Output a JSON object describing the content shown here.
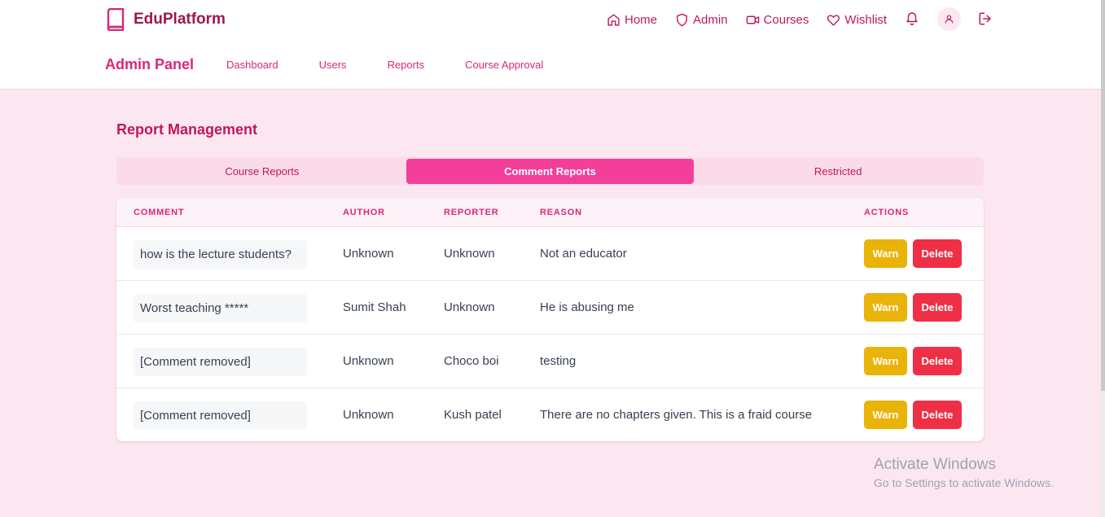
{
  "brand": {
    "name": "EduPlatform"
  },
  "topnav": [
    {
      "label": "Home",
      "icon": "home-icon"
    },
    {
      "label": "Admin",
      "icon": "shield-icon"
    },
    {
      "label": "Courses",
      "icon": "video-icon"
    },
    {
      "label": "Wishlist",
      "icon": "heart-icon"
    }
  ],
  "panel": {
    "title": "Admin Panel"
  },
  "subnav": [
    "Dashboard",
    "Users",
    "Reports",
    "Course Approval"
  ],
  "section": {
    "title": "Report Management"
  },
  "tabs": [
    {
      "label": "Course Reports",
      "active": false
    },
    {
      "label": "Comment Reports",
      "active": true
    },
    {
      "label": "Restricted",
      "active": false
    }
  ],
  "table": {
    "headers": {
      "comment": "COMMENT",
      "author": "AUTHOR",
      "reporter": "REPORTER",
      "reason": "REASON",
      "actions": "ACTIONS"
    },
    "rows": [
      {
        "comment": "how is the lecture students?",
        "author": "Unknown",
        "reporter": "Unknown",
        "reason": "Not an educator"
      },
      {
        "comment": "Worst teaching *****",
        "author": "Sumit Shah",
        "reporter": "Unknown",
        "reason": "He is abusing me"
      },
      {
        "comment": "[Comment removed]",
        "author": "Unknown",
        "reporter": "Choco boi",
        "reason": "testing"
      },
      {
        "comment": "[Comment removed]",
        "author": "Unknown",
        "reporter": "Kush patel",
        "reason": "There are no chapters given. This is a fraid course"
      }
    ],
    "warn_label": "Warn",
    "delete_label": "Delete"
  },
  "watermark": {
    "title": "Activate Windows",
    "subtitle": "Go to Settings to activate Windows."
  },
  "colors": {
    "brand": "#9d174d",
    "accent": "#db2777",
    "active_tab": "#f43f9a",
    "warn": "#eab308",
    "delete": "#ef2f45",
    "background": "#fce7f1"
  }
}
